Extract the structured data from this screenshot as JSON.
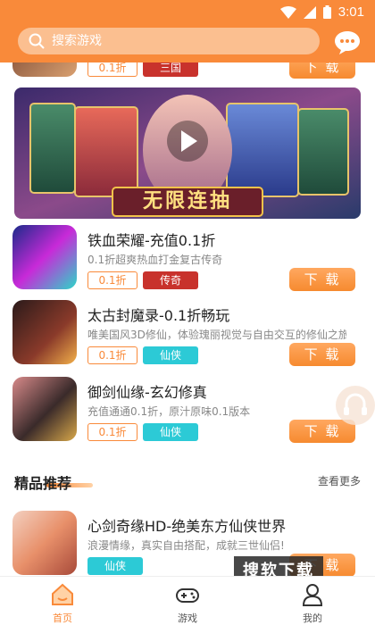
{
  "search": {
    "placeholder": "搜索游戏"
  },
  "status": {
    "time": "3:01"
  },
  "colors": {
    "accent": "#f98a3a",
    "tag_red": "#c8322c",
    "tag_teal": "#2ccad6"
  },
  "partial_item": {
    "discount": "0.1折",
    "genre": "三国",
    "download": "下 载"
  },
  "banner": {
    "text": "无限连抽",
    "icon": "play-icon"
  },
  "games": [
    {
      "title": "铁血荣耀-充值0.1折",
      "desc": "0.1折超爽热血打金复古传奇",
      "discount": "0.1折",
      "genre": "传奇",
      "download": "下 载"
    },
    {
      "title": "太古封魔录-0.1折畅玩",
      "desc": "唯美国风3D修仙，体验瑰丽视觉与自由交互的修仙之旅",
      "discount": "0.1折",
      "genre": "仙侠",
      "download": "下 载"
    },
    {
      "title": "御剑仙缘-玄幻修真",
      "desc": "充值通通0.1折，原汁原味0.1版本",
      "discount": "0.1折",
      "genre": "仙侠",
      "download": "下 载"
    }
  ],
  "section": {
    "title": "精品推荐",
    "more": "查看更多"
  },
  "featured": {
    "title": "心剑奇缘HD-绝美东方仙侠世界",
    "desc": "浪漫情缘，真实自由搭配，成就三世仙侣!",
    "genre": "仙侠",
    "download": "下 载"
  },
  "watermark": "搜软下载",
  "tabs": [
    {
      "label": "首页",
      "icon": "home-icon"
    },
    {
      "label": "游戏",
      "icon": "gamepad-icon"
    },
    {
      "label": "我的",
      "icon": "user-icon"
    }
  ]
}
